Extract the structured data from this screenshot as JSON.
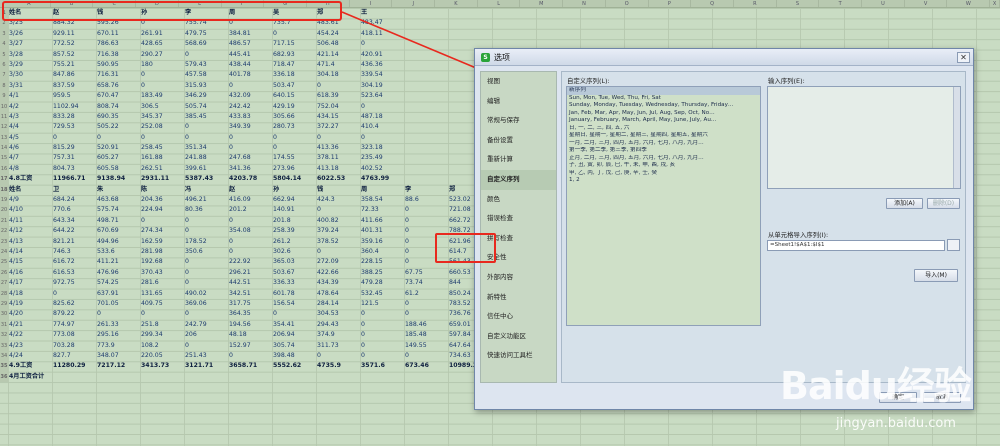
{
  "sheet": {
    "columns": [
      "A",
      "B",
      "C",
      "D",
      "E",
      "F",
      "G",
      "H",
      "I",
      "J",
      "K",
      "L",
      "M",
      "N",
      "O",
      "P",
      "Q",
      "R",
      "S",
      "T",
      "U",
      "V",
      "W",
      "X",
      "Y",
      "Z",
      "AA",
      "AB"
    ],
    "header1": [
      "姓名",
      "赵",
      "钱",
      "孙",
      "李",
      "周",
      "吴",
      "郑",
      "王"
    ],
    "rows_top": [
      [
        "3/25",
        "884.32",
        "595.26",
        "0",
        "755.74",
        "0",
        "735.7",
        "483.61",
        "483.47"
      ],
      [
        "3/26",
        "929.11",
        "670.11",
        "261.91",
        "479.75",
        "384.81",
        "0",
        "454.24",
        "418.11"
      ],
      [
        "3/27",
        "772.52",
        "786.63",
        "428.65",
        "568.69",
        "486.57",
        "717.15",
        "506.48",
        "0"
      ],
      [
        "3/28",
        "857.52",
        "716.38",
        "290.27",
        "0",
        "445.41",
        "682.93",
        "421.14",
        "420.91"
      ],
      [
        "3/29",
        "755.21",
        "590.95",
        "180",
        "579.43",
        "438.44",
        "718.47",
        "471.4",
        "436.36"
      ],
      [
        "3/30",
        "847.86",
        "716.31",
        "0",
        "457.58",
        "401.78",
        "336.18",
        "304.18",
        "339.54"
      ],
      [
        "3/31",
        "837.59",
        "658.76",
        "0",
        "315.93",
        "0",
        "503.47",
        "0",
        "304.19"
      ],
      [
        "4/1",
        "959.5",
        "670.47",
        "183.49",
        "346.29",
        "432.09",
        "640.15",
        "618.39",
        "523.64"
      ],
      [
        "4/2",
        "1102.94",
        "808.74",
        "306.5",
        "505.74",
        "242.42",
        "429.19",
        "752.04",
        "0"
      ],
      [
        "4/3",
        "833.28",
        "690.35",
        "345.37",
        "385.45",
        "433.83",
        "305.66",
        "434.15",
        "487.18"
      ],
      [
        "4/4",
        "729.53",
        "505.22",
        "252.08",
        "0",
        "349.39",
        "280.73",
        "372.27",
        "410.4"
      ],
      [
        "4/5",
        "0",
        "0",
        "0",
        "0",
        "0",
        "0",
        "0",
        "0"
      ],
      [
        "4/6",
        "815.29",
        "520.91",
        "258.45",
        "351.34",
        "0",
        "0",
        "413.36",
        "323.18"
      ],
      [
        "4/7",
        "757.31",
        "605.27",
        "161.88",
        "241.88",
        "247.68",
        "174.55",
        "378.11",
        "235.49"
      ],
      [
        "4/8",
        "804.73",
        "605.58",
        "262.51",
        "399.61",
        "341.36",
        "273.96",
        "413.18",
        "402.52"
      ]
    ],
    "total1": [
      "4.8工资",
      "11966.71",
      "9138.94",
      "2931.11",
      "5387.43",
      "4203.78",
      "5804.14",
      "6022.53",
      "4763.99"
    ],
    "header2": [
      "姓名",
      "卫",
      "朱",
      "陈",
      "冯",
      "赵",
      "孙",
      "钱",
      "周",
      "李",
      "郑",
      "吴",
      "王"
    ],
    "rows_bottom": [
      [
        "4/9",
        "684.24",
        "463.68",
        "204.36",
        "496.21",
        "416.09",
        "662.94",
        "424.3",
        "358.54",
        "88.6",
        "523.02",
        "388.21",
        "342.95"
      ],
      [
        "4/10",
        "770.6",
        "575.74",
        "224.94",
        "80.36",
        "201.2",
        "140.91",
        "0",
        "72.33",
        "0",
        "721.08",
        "289.55",
        "320.22"
      ],
      [
        "4/11",
        "643.34",
        "498.71",
        "0",
        "0",
        "0",
        "201.8",
        "400.82",
        "411.66",
        "0",
        "662.72",
        "0",
        "421.28"
      ],
      [
        "4/12",
        "644.22",
        "670.69",
        "274.34",
        "0",
        "354.08",
        "258.39",
        "379.24",
        "401.31",
        "0",
        "788.72",
        "350.21",
        "452.16"
      ],
      [
        "4/13",
        "821.21",
        "494.96",
        "162.59",
        "178.52",
        "0",
        "261.2",
        "378.52",
        "359.16",
        "0",
        "621.96",
        "398.9",
        "0"
      ],
      [
        "4/14",
        "746.3",
        "533.6",
        "281.98",
        "350.6",
        "0",
        "302.6",
        "0",
        "360.4",
        "0",
        "614.7",
        "504.66",
        "0"
      ],
      [
        "4/15",
        "616.72",
        "411.21",
        "192.68",
        "0",
        "222.92",
        "365.03",
        "272.09",
        "228.15",
        "0",
        "561.43",
        "259.33",
        "246.81"
      ],
      [
        "4/16",
        "616.53",
        "476.96",
        "370.43",
        "0",
        "296.21",
        "503.67",
        "422.66",
        "388.25",
        "67.75",
        "660.53",
        "434.03",
        "354.59"
      ],
      [
        "4/17",
        "972.75",
        "574.25",
        "281.6",
        "0",
        "442.51",
        "336.33",
        "434.39",
        "479.28",
        "73.74",
        "844",
        "271.4",
        "0"
      ],
      [
        "4/18",
        "0",
        "637.91",
        "131.65",
        "490.02",
        "342.51",
        "601.78",
        "478.64",
        "532.45",
        "61.2",
        "850.24",
        "24.3",
        "452.21"
      ],
      [
        "4/19",
        "825.62",
        "701.05",
        "409.75",
        "369.06",
        "317.75",
        "156.54",
        "284.14",
        "121.5",
        "0",
        "783.52",
        "383.52",
        "457.21"
      ],
      [
        "4/20",
        "879.22",
        "0",
        "0",
        "0",
        "364.35",
        "0",
        "304.53",
        "0",
        "0",
        "736.76",
        "317.76",
        "228.7"
      ],
      [
        "4/21",
        "774.97",
        "261.33",
        "251.8",
        "242.79",
        "194.56",
        "354.41",
        "294.43",
        "0",
        "188.46",
        "659.01",
        "368.72",
        "0"
      ],
      [
        "4/22",
        "773.08",
        "295.16",
        "299.34",
        "206",
        "48.18",
        "206.94",
        "374.9",
        "0",
        "185.48",
        "597.84",
        "368.72",
        "0"
      ],
      [
        "4/23",
        "703.28",
        "773.9",
        "108.2",
        "0",
        "152.97",
        "305.74",
        "311.73",
        "0",
        "149.55",
        "647.64",
        "305.78",
        "0"
      ],
      [
        "4/24",
        "827.7",
        "348.07",
        "220.05",
        "251.43",
        "0",
        "398.48",
        "0",
        "0",
        "0",
        "734.63",
        "385.82",
        "0"
      ]
    ],
    "total2": [
      "4.9工资",
      "11280.29",
      "7217.12",
      "3413.73",
      "3121.71",
      "3658.71",
      "5552.62",
      "4735.9",
      "3571.6",
      "673.46",
      "10989.3",
      "4942.43",
      "3794.11"
    ],
    "last_row": "4月工资合计"
  },
  "dialog": {
    "title": "选项",
    "close": "✕",
    "nav": [
      "视图",
      "编辑",
      "常规与保存",
      "备份设置",
      "重新计算",
      "自定义序列",
      "颜色",
      "错误检查",
      "拼写检查",
      "安全性",
      "外部内容",
      "新特性",
      "信任中心",
      "自定义功能区",
      "快速访问工具栏"
    ],
    "list_label": "自定义序列(L):",
    "input_label": "输入序列(E):",
    "list_items": [
      "新序列",
      "Sun, Mon, Tue, Wed, Thu, Fri, Sat",
      "Sunday, Monday, Tuesday, Wednesday, Thursday, Friday…",
      "Jan, Feb, Mar, Apr, May, Jun, Jul, Aug, Sep, Oct, No…",
      "January, February, March, April, May, June, July, Au…",
      "日, 一, 二, 三, 四, 五, 六",
      "星期日, 星期一, 星期二, 星期三, 星期四, 星期五, 星期六",
      "一月, 二月, 三月, 四月, 五月, 六月, 七月, 八月, 九月…",
      "第一季, 第二季, 第三季, 第四季",
      "正月, 二月, 三月, 四月, 五月, 六月, 七月, 八月, 九月…",
      "子, 丑, 寅, 卯, 辰, 巳, 午, 未, 申, 酉, 戌, 亥",
      "甲, 乙, 丙, 丁, 戊, 己, 庚, 辛, 壬, 癸",
      "1, 2"
    ],
    "add_button": "添加(A)",
    "delete_button": "删除(D)",
    "import_label": "从单元格导入序列(I):",
    "import_ref": "=Sheet1!$A$1:$I$1",
    "import_button": "导入(M)",
    "ok_button": "确定",
    "cancel_button": "取消"
  },
  "watermark": {
    "brand": "Baidu经验",
    "url": "jingyan.baidu.com"
  },
  "colors": {
    "highlight": "#e8291e",
    "grid_bg": "#c9dcc3",
    "dialog_bg": "#dde5f0"
  }
}
